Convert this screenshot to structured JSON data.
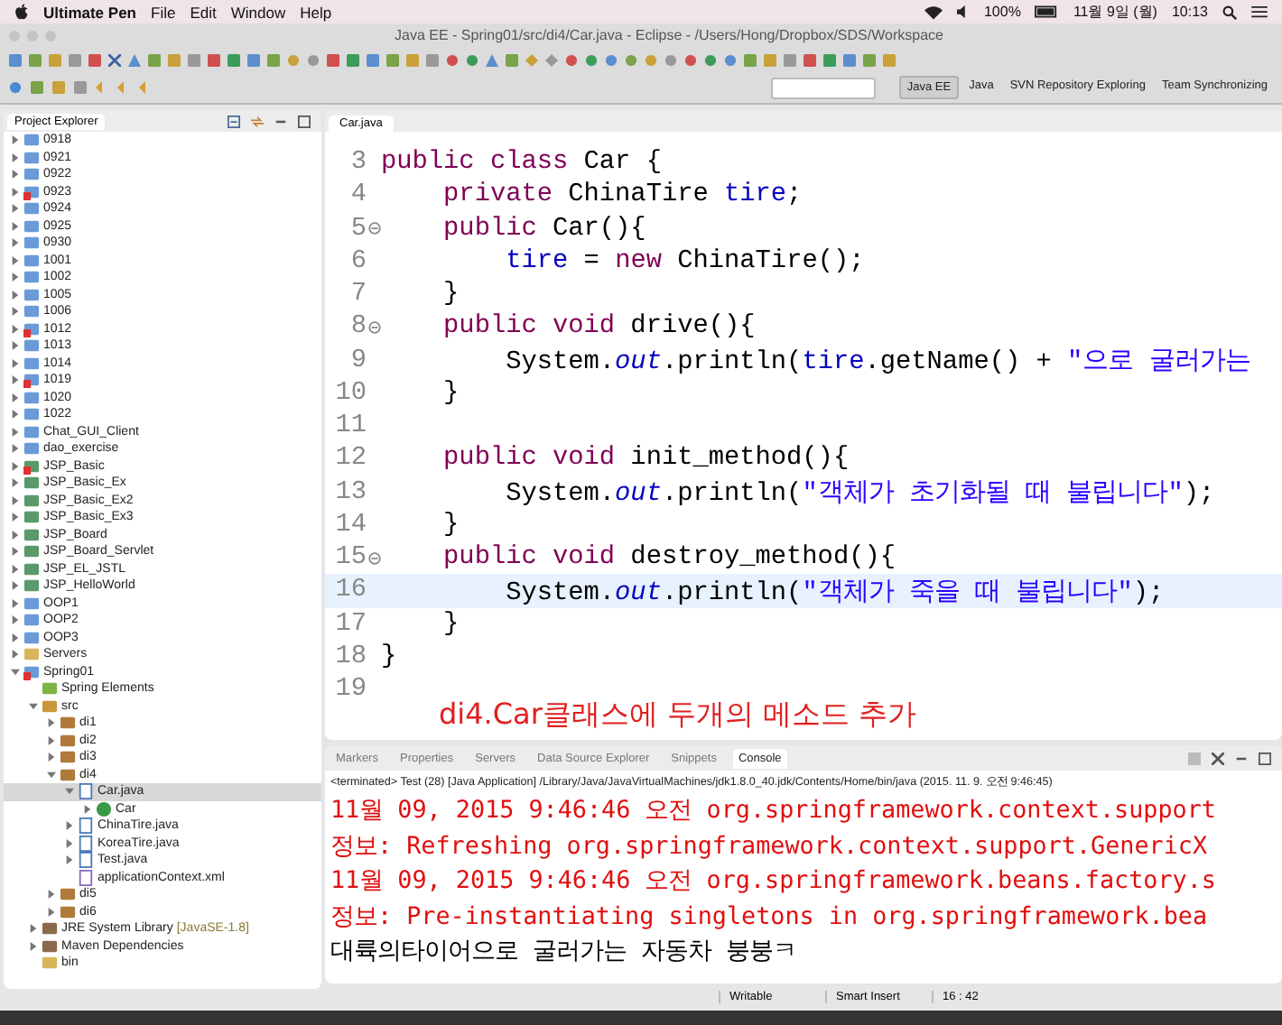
{
  "menubar": {
    "app": "Ultimate Pen",
    "items": [
      "File",
      "Edit",
      "Window",
      "Help"
    ],
    "battery": "100%",
    "date": "11월 9일 (월)",
    "time": "10:13"
  },
  "window": {
    "title": "Java EE - Spring01/src/di4/Car.java - Eclipse - /Users/Hong/Dropbox/SDS/Workspace"
  },
  "perspectives": [
    {
      "label": "Java EE",
      "selected": true
    },
    {
      "label": "Java",
      "selected": false
    },
    {
      "label": "SVN Repository Exploring",
      "selected": false
    },
    {
      "label": "Team Synchronizing",
      "selected": false
    }
  ],
  "explorer": {
    "title": "Project Explorer",
    "items": [
      {
        "label": "0918",
        "kind": "project",
        "error": false,
        "expanded": false,
        "selected": false
      },
      {
        "label": "0921",
        "kind": "project",
        "error": false,
        "expanded": false,
        "selected": false
      },
      {
        "label": "0922",
        "kind": "project",
        "error": false,
        "expanded": false,
        "selected": false
      },
      {
        "label": "0923",
        "kind": "project",
        "error": true,
        "expanded": false,
        "selected": false
      },
      {
        "label": "0924",
        "kind": "project",
        "error": false,
        "expanded": false,
        "selected": false
      },
      {
        "label": "0925",
        "kind": "project",
        "error": false,
        "expanded": false,
        "selected": false
      },
      {
        "label": "0930",
        "kind": "project",
        "error": false,
        "expanded": false,
        "selected": false
      },
      {
        "label": "1001",
        "kind": "project",
        "error": false,
        "expanded": false,
        "selected": false
      },
      {
        "label": "1002",
        "kind": "project",
        "error": false,
        "expanded": false,
        "selected": false
      },
      {
        "label": "1005",
        "kind": "project",
        "error": false,
        "expanded": false,
        "selected": false
      },
      {
        "label": "1006",
        "kind": "project",
        "error": false,
        "expanded": false,
        "selected": false
      },
      {
        "label": "1012",
        "kind": "project",
        "error": true,
        "expanded": false,
        "selected": false
      },
      {
        "label": "1013",
        "kind": "project",
        "error": false,
        "expanded": false,
        "selected": false
      },
      {
        "label": "1014",
        "kind": "project",
        "error": false,
        "expanded": false,
        "selected": false
      },
      {
        "label": "1019",
        "kind": "project",
        "error": true,
        "expanded": false,
        "selected": false
      },
      {
        "label": "1020",
        "kind": "project",
        "error": false,
        "expanded": false,
        "selected": false
      },
      {
        "label": "1022",
        "kind": "project",
        "error": false,
        "expanded": false,
        "selected": false
      },
      {
        "label": "Chat_GUI_Client",
        "kind": "project",
        "error": false,
        "expanded": false,
        "selected": false
      },
      {
        "label": "dao_exercise",
        "kind": "project",
        "error": false,
        "expanded": false,
        "selected": false
      },
      {
        "label": "JSP_Basic",
        "kind": "web",
        "error": true,
        "expanded": false,
        "selected": false
      },
      {
        "label": "JSP_Basic_Ex",
        "kind": "web",
        "error": false,
        "expanded": false,
        "selected": false
      },
      {
        "label": "JSP_Basic_Ex2",
        "kind": "web",
        "error": false,
        "expanded": false,
        "selected": false
      },
      {
        "label": "JSP_Basic_Ex3",
        "kind": "web",
        "error": false,
        "expanded": false,
        "selected": false
      },
      {
        "label": "JSP_Board",
        "kind": "web",
        "error": false,
        "expanded": false,
        "selected": false
      },
      {
        "label": "JSP_Board_Servlet",
        "kind": "web",
        "error": false,
        "expanded": false,
        "selected": false
      },
      {
        "label": "JSP_EL_JSTL",
        "kind": "web",
        "error": false,
        "expanded": false,
        "selected": false
      },
      {
        "label": "JSP_HelloWorld",
        "kind": "web",
        "error": false,
        "expanded": false,
        "selected": false
      },
      {
        "label": "OOP1",
        "kind": "project",
        "error": false,
        "expanded": false,
        "selected": false
      },
      {
        "label": "OOP2",
        "kind": "project",
        "error": false,
        "expanded": false,
        "selected": false
      },
      {
        "label": "OOP3",
        "kind": "project",
        "error": false,
        "expanded": false,
        "selected": false
      },
      {
        "label": "Servers",
        "kind": "folder",
        "error": false,
        "expanded": false,
        "selected": false
      },
      {
        "label": "Spring01",
        "kind": "project",
        "error": true,
        "expanded": true,
        "selected": false,
        "children": [
          {
            "label": "Spring Elements",
            "kind": "spring",
            "error": false,
            "selected": false
          },
          {
            "label": "src",
            "kind": "src",
            "error": false,
            "expanded": true,
            "selected": false,
            "children": [
              {
                "label": "di1",
                "kind": "package",
                "error": false,
                "expanded": false,
                "selected": false
              },
              {
                "label": "di2",
                "kind": "package",
                "error": false,
                "expanded": false,
                "selected": false
              },
              {
                "label": "di3",
                "kind": "package",
                "error": false,
                "expanded": false,
                "selected": false
              },
              {
                "label": "di4",
                "kind": "package",
                "error": false,
                "expanded": true,
                "selected": false,
                "children": [
                  {
                    "label": "Car.java",
                    "kind": "java",
                    "error": false,
                    "expanded": true,
                    "selected": true,
                    "children": [
                      {
                        "label": "Car",
                        "kind": "class",
                        "error": false,
                        "expanded": false,
                        "selected": false
                      }
                    ]
                  },
                  {
                    "label": "ChinaTire.java",
                    "kind": "java",
                    "error": false,
                    "expanded": false,
                    "selected": false
                  },
                  {
                    "label": "KoreaTire.java",
                    "kind": "java",
                    "error": false,
                    "expanded": false,
                    "selected": false
                  },
                  {
                    "label": "Test.java",
                    "kind": "java",
                    "error": false,
                    "expanded": false,
                    "selected": false
                  },
                  {
                    "label": "applicationContext.xml",
                    "kind": "xml",
                    "error": false,
                    "selected": false
                  }
                ]
              },
              {
                "label": "di5",
                "kind": "package",
                "error": false,
                "expanded": false,
                "selected": false
              },
              {
                "label": "di6",
                "kind": "package",
                "error": false,
                "expanded": false,
                "selected": false
              }
            ]
          },
          {
            "label": "JRE System Library",
            "suffix": "[JavaSE-1.8]",
            "kind": "library",
            "error": false,
            "expanded": false,
            "selected": false
          },
          {
            "label": "Maven Dependencies",
            "kind": "library",
            "error": false,
            "expanded": false,
            "selected": false
          },
          {
            "label": "bin",
            "kind": "folder",
            "error": false,
            "selected": false
          }
        ]
      }
    ]
  },
  "editor": {
    "tab": "Car.java",
    "lines": [
      {
        "number": "3",
        "fold": false,
        "current": false,
        "tokens": [
          {
            "kind": "kw",
            "text": "public class"
          },
          {
            "kind": "plain",
            "text": " Car {"
          }
        ]
      },
      {
        "number": "4",
        "fold": false,
        "current": false,
        "tokens": [
          {
            "kind": "kw",
            "text": "    private"
          },
          {
            "kind": "plain",
            "text": " ChinaTire "
          },
          {
            "kind": "field",
            "text": "tire"
          },
          {
            "kind": "plain",
            "text": ";"
          }
        ]
      },
      {
        "number": "5",
        "fold": true,
        "current": false,
        "tokens": [
          {
            "kind": "kw",
            "text": "    public"
          },
          {
            "kind": "plain",
            "text": " Car(){"
          }
        ]
      },
      {
        "number": "6",
        "fold": false,
        "current": false,
        "tokens": [
          {
            "kind": "field",
            "text": "        tire"
          },
          {
            "kind": "plain",
            "text": " = "
          },
          {
            "kind": "kw",
            "text": "new"
          },
          {
            "kind": "plain",
            "text": " ChinaTire();"
          }
        ]
      },
      {
        "number": "7",
        "fold": false,
        "current": false,
        "tokens": [
          {
            "kind": "plain",
            "text": "    }"
          }
        ]
      },
      {
        "number": "8",
        "fold": true,
        "current": false,
        "tokens": [
          {
            "kind": "kw",
            "text": "    public void"
          },
          {
            "kind": "plain",
            "text": " drive(){"
          }
        ]
      },
      {
        "number": "9",
        "fold": false,
        "current": false,
        "tokens": [
          {
            "kind": "plain",
            "text": "        System."
          },
          {
            "kind": "static",
            "text": "out"
          },
          {
            "kind": "plain",
            "text": ".println("
          },
          {
            "kind": "field",
            "text": "tire"
          },
          {
            "kind": "plain",
            "text": ".getName() + "
          },
          {
            "kind": "str",
            "text": "\"으로 굴러가는"
          }
        ]
      },
      {
        "number": "10",
        "fold": false,
        "current": false,
        "tokens": [
          {
            "kind": "plain",
            "text": "    }"
          }
        ]
      },
      {
        "number": "11",
        "fold": false,
        "current": false
      },
      {
        "number": "12",
        "fold": false,
        "current": false,
        "tokens": [
          {
            "kind": "kw",
            "text": "    public void"
          },
          {
            "kind": "plain",
            "text": " init_method(){"
          }
        ]
      },
      {
        "number": "13",
        "fold": false,
        "current": false,
        "tokens": [
          {
            "kind": "plain",
            "text": "        System."
          },
          {
            "kind": "static",
            "text": "out"
          },
          {
            "kind": "plain",
            "text": ".println("
          },
          {
            "kind": "str",
            "text": "\"객체가 초기화될 때 불립니다\""
          },
          {
            "kind": "plain",
            "text": ");"
          }
        ]
      },
      {
        "number": "14",
        "fold": false,
        "current": false,
        "tokens": [
          {
            "kind": "plain",
            "text": "    }"
          }
        ]
      },
      {
        "number": "15",
        "fold": true,
        "current": false,
        "tokens": [
          {
            "kind": "kw",
            "text": "    public void"
          },
          {
            "kind": "plain",
            "text": " destroy_method(){"
          }
        ]
      },
      {
        "number": "16",
        "fold": false,
        "current": true,
        "tokens": [
          {
            "kind": "plain",
            "text": "        System."
          },
          {
            "kind": "static",
            "text": "out"
          },
          {
            "kind": "plain",
            "text": ".println("
          },
          {
            "kind": "str",
            "text": "\"객체가 죽을 때 불립니다\""
          },
          {
            "kind": "plain",
            "text": ");"
          }
        ]
      },
      {
        "number": "17",
        "fold": false,
        "current": false,
        "tokens": [
          {
            "kind": "plain",
            "text": "    }"
          }
        ]
      },
      {
        "number": "18",
        "fold": false,
        "current": false,
        "tokens": [
          {
            "kind": "plain",
            "text": "}"
          }
        ]
      },
      {
        "number": "19",
        "fold": false,
        "current": false
      }
    ],
    "annotation": "di4.Car클래스에 두개의 메소드 추가"
  },
  "console": {
    "tabs": [
      {
        "label": "Markers",
        "selected": false
      },
      {
        "label": "Properties",
        "selected": false
      },
      {
        "label": "Servers",
        "selected": false
      },
      {
        "label": "Data Source Explorer",
        "selected": false
      },
      {
        "label": "Snippets",
        "selected": false
      },
      {
        "label": "Console",
        "selected": true
      }
    ],
    "header": "<terminated> Test (28) [Java Application] /Library/Java/JavaVirtualMachines/jdk1.8.0_40.jdk/Contents/Home/bin/java (2015. 11. 9. 오전 9:46:45)",
    "lines": [
      {
        "kind": "stderr",
        "text": "11월 09, 2015 9:46:46 오전 org.springframework.context.support"
      },
      {
        "kind": "stderr",
        "text": "정보: Refreshing org.springframework.context.support.GenericX"
      },
      {
        "kind": "stderr",
        "text": "11월 09, 2015 9:46:46 오전 org.springframework.beans.factory.s"
      },
      {
        "kind": "stderr",
        "text": "정보: Pre-instantiating singletons in org.springframework.bea"
      },
      {
        "kind": "stdout",
        "text": "대륙의타이어으로 굴러가는 자동차 붕붕ㅋ"
      }
    ]
  },
  "status_bar": {
    "mode": "Writable",
    "insert": "Smart Insert",
    "position": "16 : 42"
  }
}
